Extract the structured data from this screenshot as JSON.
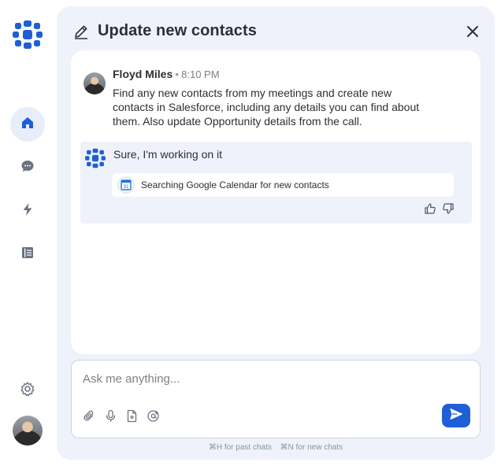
{
  "panel": {
    "title": "Update new contacts"
  },
  "conversation": {
    "user_message": {
      "author": "Floyd Miles",
      "separator": "•",
      "time": "8:10 PM",
      "text": "Find any new contacts from my meetings and create new contacts in Salesforce, including any details you can find about them. Also update Opportunity details from the call."
    },
    "assistant_reply": {
      "text": "Sure, I'm working on it",
      "status": {
        "calendar_day": "31",
        "text": "Searching Google Calendar for new contacts"
      }
    }
  },
  "composer": {
    "placeholder": "Ask me anything..."
  },
  "hints": {
    "past_chats": "⌘H for past chats",
    "new_chats": "⌘N for new chats"
  },
  "icons": {
    "sidebar": [
      "logo-icon",
      "home-icon",
      "chat-icon",
      "bolt-icon",
      "book-icon",
      "gear-icon"
    ],
    "composer": [
      "paperclip-icon",
      "microphone-icon",
      "file-add-icon",
      "mention-icon",
      "send-icon"
    ]
  },
  "colors": {
    "brand_blue": "#1f5fd6",
    "panel_bg": "#eff2fb",
    "active_nav_bg": "#e8edfa"
  }
}
